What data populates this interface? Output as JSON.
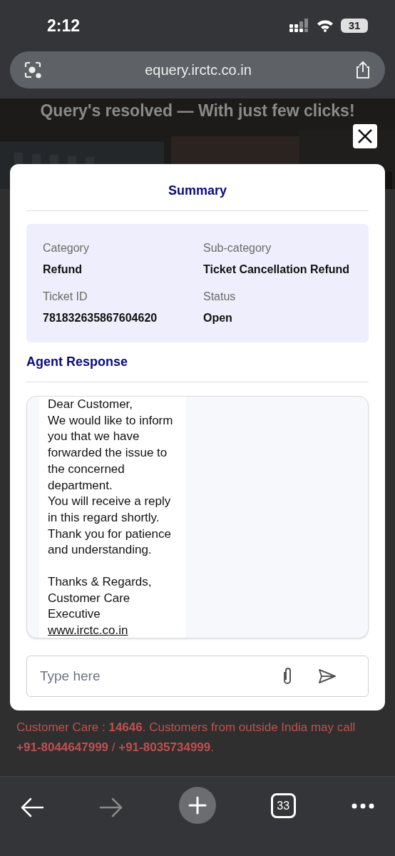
{
  "status_bar": {
    "time": "2:12",
    "battery": "31"
  },
  "browser": {
    "url": "equery.irctc.co.in",
    "tab_count": "33",
    "forward_disabled": true
  },
  "page": {
    "banner_heading": "Query's resolved — With just few clicks!",
    "footer_lines": [
      "Customer Care : **14646**. Customers from outside India may call",
      "**+91-8044647999** / **+91-8035734999**."
    ]
  },
  "modal": {
    "title": "Summary",
    "fields": [
      {
        "label": "Category",
        "value": "Refund"
      },
      {
        "label": "Sub-category",
        "value": "Ticket Cancellation Refund"
      },
      {
        "label": "Ticket ID",
        "value": "781832635867604620"
      },
      {
        "label": "Status",
        "value": "Open"
      }
    ],
    "response_heading": "Agent Response",
    "message": {
      "paragraphs": [
        [
          "Dear Customer,",
          "We would like to inform you that we have forwarded the issue to the concerned department.",
          "You will receive a reply in this regard shortly.",
          "Thank you for patience and understanding."
        ],
        [
          "Thanks & Regards,",
          "Customer Care Executive"
        ]
      ],
      "link": "www.irctc.co.in"
    },
    "input": {
      "placeholder": "Type here"
    }
  }
}
